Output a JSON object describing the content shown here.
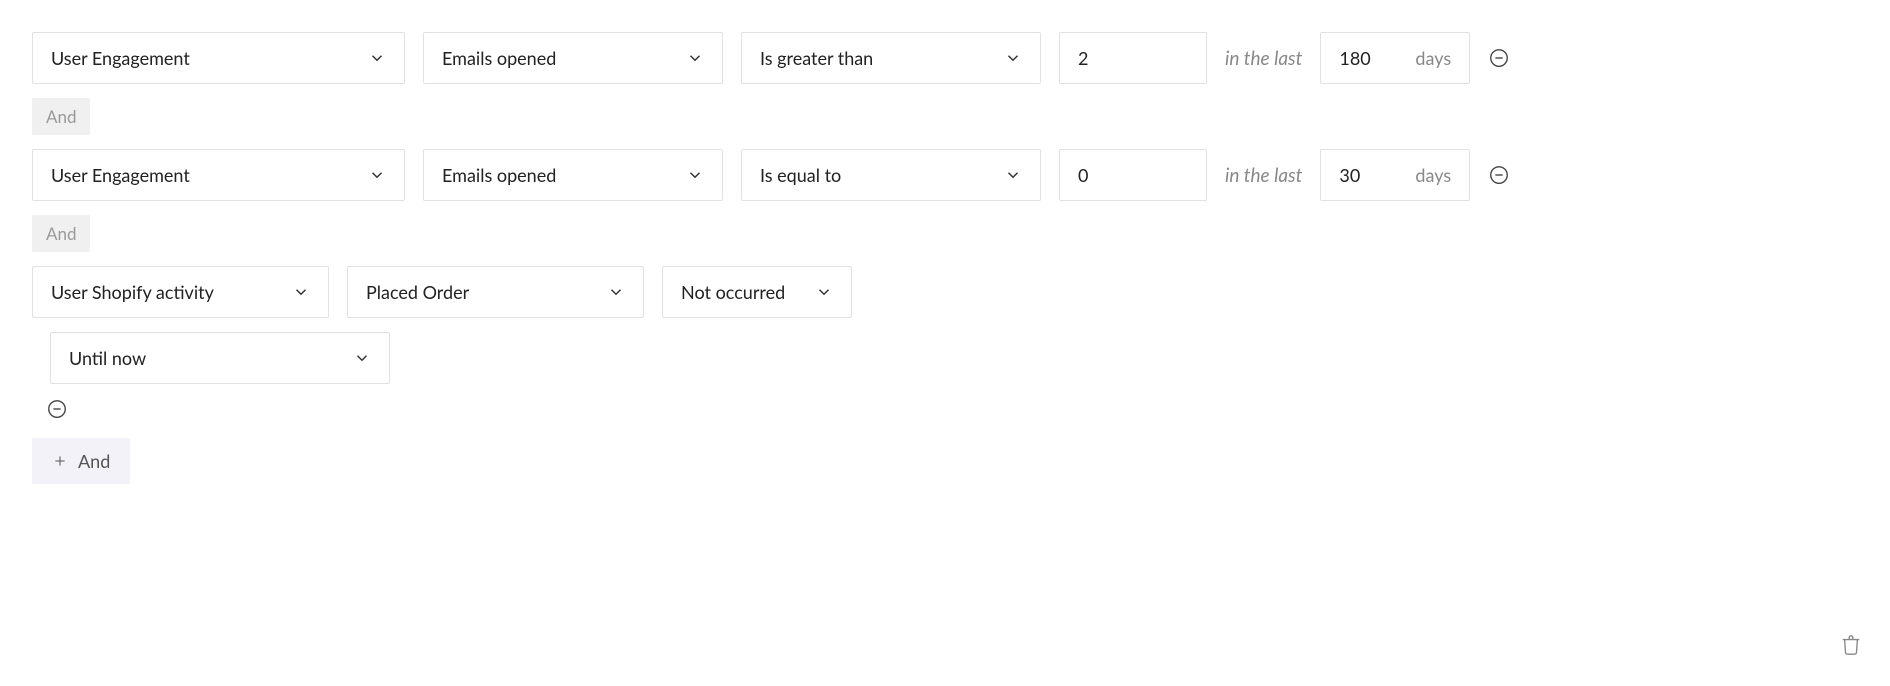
{
  "connectors": {
    "and": "And"
  },
  "rules": [
    {
      "category": "User Engagement",
      "metric": "Emails opened",
      "operator": "Is greater than",
      "value": "2",
      "in_last_label": "in the last",
      "days_value": "180",
      "days_suffix": "days"
    },
    {
      "category": "User Engagement",
      "metric": "Emails opened",
      "operator": "Is equal to",
      "value": "0",
      "in_last_label": "in the last",
      "days_value": "30",
      "days_suffix": "days"
    },
    {
      "category": "User Shopify activity",
      "action": "Placed Order",
      "operator": "Not occurred",
      "timeframe": "Until now"
    }
  ],
  "add_button": "And"
}
